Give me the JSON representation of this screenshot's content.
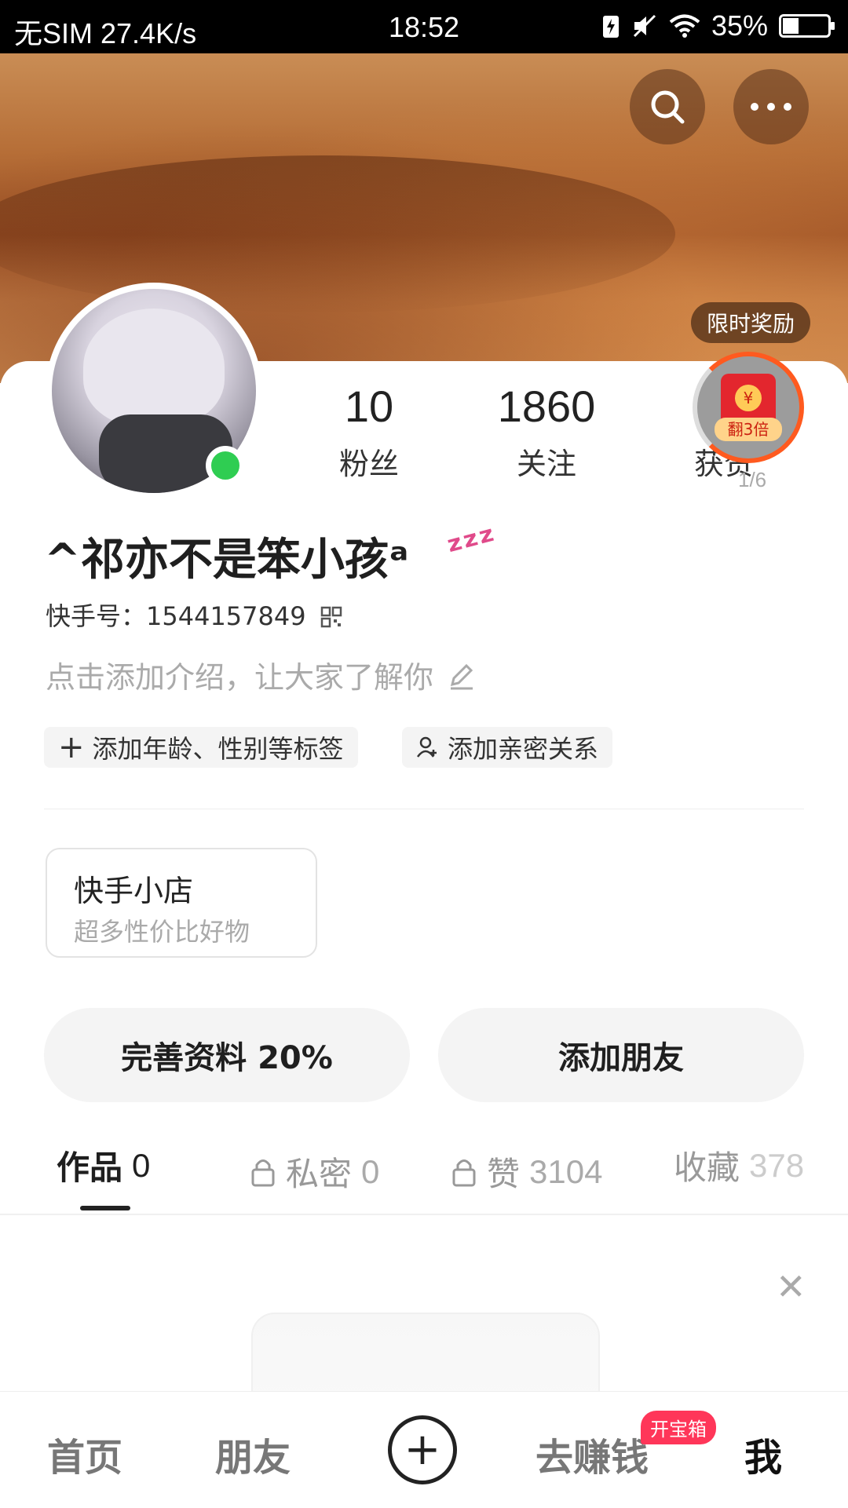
{
  "status_bar": {
    "carrier": "无SIM 27.4K/s",
    "time": "18:52",
    "battery": "35%",
    "battery_level": 0.35
  },
  "header": {
    "search_icon": "search-icon",
    "more_icon": "more-icon"
  },
  "profile": {
    "name": "^祁亦不是笨小孩ᵃ",
    "sleep_badge": "ᶻᶻᶻ",
    "uid": "快手号：1544157849",
    "bio_placeholder": "点击添加介绍，让大家了解你",
    "online": true
  },
  "stats": [
    {
      "value": "10",
      "label": "粉丝"
    },
    {
      "value": "1860",
      "label": "关注"
    },
    {
      "value": "",
      "label": "获赞"
    }
  ],
  "reward": {
    "tag": "限时奖励",
    "badge": "翻3倍",
    "coin": "¥",
    "count": "1/6"
  },
  "chips": {
    "tags": "添加年龄、性别等标签",
    "relation": "添加亲密关系"
  },
  "shop": {
    "title": "快手小店",
    "subtitle": "超多性价比好物"
  },
  "actions": {
    "complete_profile": "完善资料 20%",
    "add_friend": "添加朋友"
  },
  "tabs": [
    {
      "label": "作品",
      "count": "0",
      "locked": false
    },
    {
      "label": "私密",
      "count": "0",
      "locked": true
    },
    {
      "label": "赞",
      "count": "3104",
      "locked": true
    },
    {
      "label": "收藏",
      "count": "378",
      "locked": false
    }
  ],
  "bottom_nav": {
    "home": "首页",
    "friends": "朋友",
    "earn": "去赚钱",
    "earn_badge": "开宝箱",
    "me": "我"
  }
}
